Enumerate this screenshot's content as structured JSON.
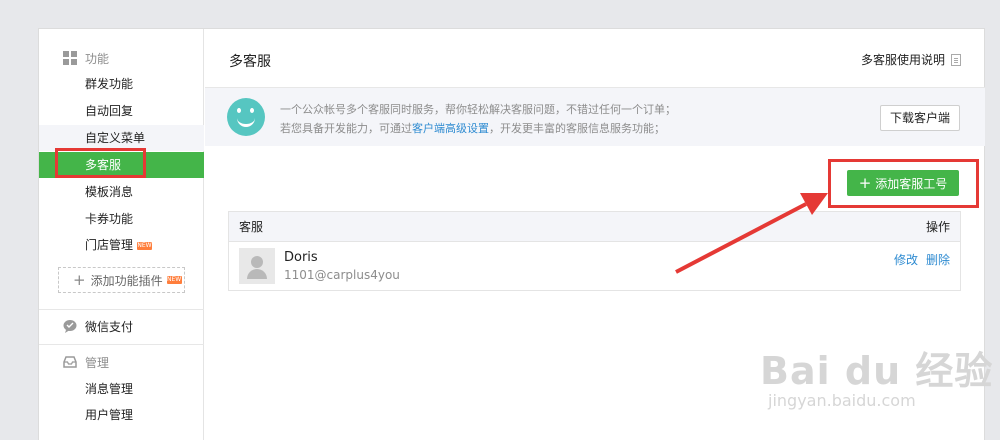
{
  "sidebar": {
    "function_section": "功能",
    "function_items": [
      {
        "label": "群发功能"
      },
      {
        "label": "自动回复"
      },
      {
        "label": "自定义菜单"
      },
      {
        "label": "多客服"
      },
      {
        "label": "模板消息"
      },
      {
        "label": "卡券功能"
      },
      {
        "label": "门店管理",
        "tag": "NEW"
      }
    ],
    "add_plugin": {
      "label": "添加功能插件",
      "tag": "NEW"
    },
    "payment_section": "微信支付",
    "manage_section": "管理",
    "manage_items": [
      {
        "label": "消息管理"
      },
      {
        "label": "用户管理"
      }
    ]
  },
  "main": {
    "title": "多客服",
    "help_label": "多客服使用说明",
    "notice": {
      "line1": "一个公众帐号多个客服同时服务，帮你轻松解决客服问题，不错过任何一个订单；",
      "line2_prefix": "若您具备开发能力，可通过",
      "line2_link": "客户端高级设置",
      "line2_suffix": "，开发更丰富的客服信息服务功能；"
    },
    "download_label": "下载客户端",
    "add_button_label": "添加客服工号",
    "table": {
      "col_agent": "客服",
      "col_ops": "操作",
      "rows": [
        {
          "name": "Doris",
          "account": "1101@carplus4you",
          "edit": "修改",
          "delete": "删除"
        }
      ]
    }
  },
  "watermark": {
    "brand": "Bai du 经验",
    "url": "jingyan.baidu.com"
  },
  "colors": {
    "accent": "#44b549",
    "highlight": "#e53935",
    "link": "#2e8bd1"
  }
}
